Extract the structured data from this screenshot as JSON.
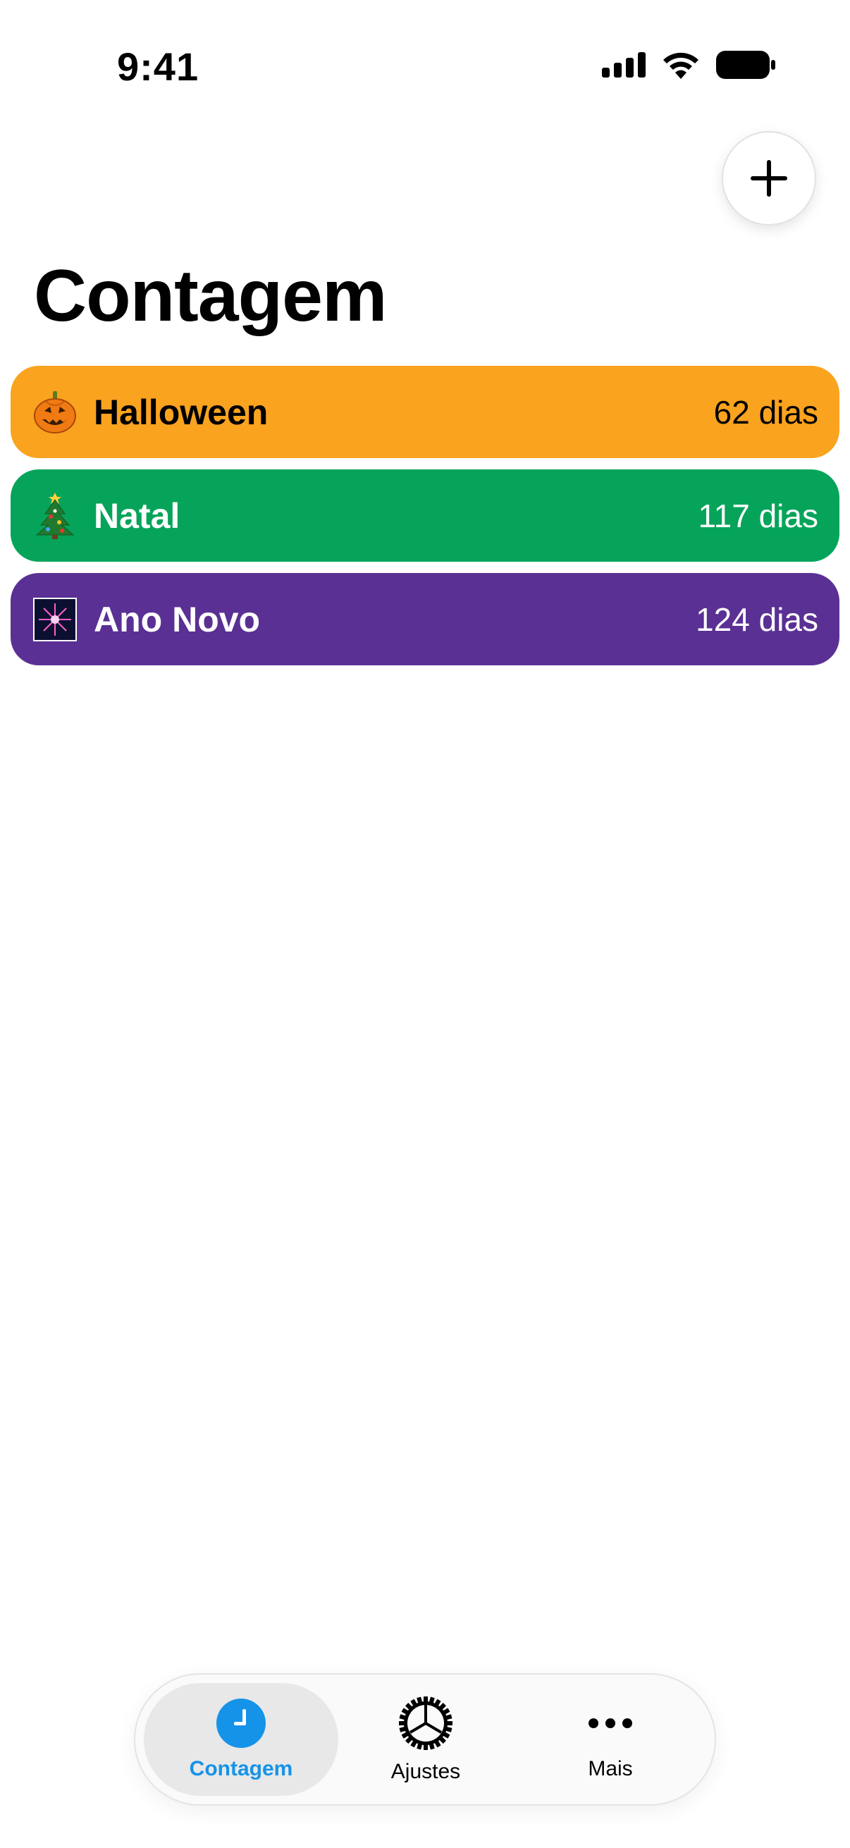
{
  "status_bar": {
    "time": "9:41"
  },
  "header": {
    "title": "Contagem",
    "add_icon": "plus-icon"
  },
  "countdowns": [
    {
      "name": "Halloween",
      "days": "62 dias",
      "color": "#F9A31F",
      "text_color": "#000000",
      "icon": "jack-o-lantern-icon"
    },
    {
      "name": "Natal",
      "days": "117 dias",
      "color": "#06A45A",
      "text_color": "#ffffff",
      "icon": "christmas-tree-icon"
    },
    {
      "name": "Ano Novo",
      "days": "124 dias",
      "color": "#5A3094",
      "text_color": "#ffffff",
      "icon": "fireworks-icon"
    }
  ],
  "tab_bar": {
    "tabs": [
      {
        "label": "Contagem",
        "icon": "clock-icon",
        "active": true
      },
      {
        "label": "Ajustes",
        "icon": "gear-icon",
        "active": false
      },
      {
        "label": "Mais",
        "icon": "ellipsis-icon",
        "active": false
      }
    ],
    "accent_color": "#1593E8"
  }
}
